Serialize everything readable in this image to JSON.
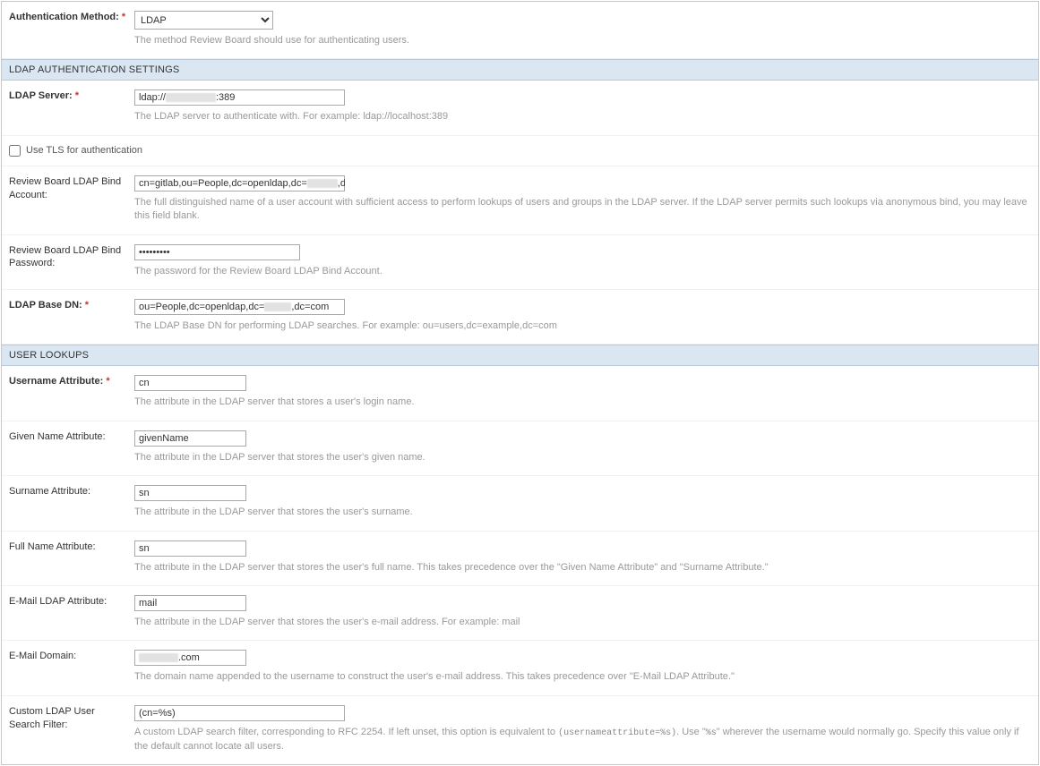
{
  "auth_method": {
    "label": "Authentication Method:",
    "required": "*",
    "value": "LDAP",
    "options": [
      "LDAP"
    ],
    "help": "The method Review Board should use for authenticating users."
  },
  "sections": {
    "ldap_settings_header": "LDAP AUTHENTICATION SETTINGS",
    "user_lookups_header": "USER LOOKUPS"
  },
  "ldap": {
    "server": {
      "label": "LDAP Server:",
      "required": "*",
      "value_prefix": "ldap://",
      "value_suffix": ":389",
      "help": "The LDAP server to authenticate with. For example: ldap://localhost:389"
    },
    "use_tls_label": "Use TLS for authentication",
    "bind_account": {
      "label": "Review Board LDAP Bind Account:",
      "value_prefix": "cn=gitlab,ou=People,dc=openldap,dc=",
      "value_suffix": ",dc=",
      "help": "The full distinguished name of a user account with sufficient access to perform lookups of users and groups in the LDAP server. If the LDAP server permits such lookups via anonymous bind, you may leave this field blank."
    },
    "bind_password": {
      "label": "Review Board LDAP Bind Password:",
      "value": "•••••••••",
      "help": "The password for the Review Board LDAP Bind Account."
    },
    "base_dn": {
      "label": "LDAP Base DN:",
      "required": "*",
      "value_prefix": "ou=People,dc=openldap,dc=",
      "value_suffix": ",dc=com",
      "help": "The LDAP Base DN for performing LDAP searches. For example: ou=users,dc=example,dc=com"
    }
  },
  "lookups": {
    "username_attr": {
      "label": "Username Attribute:",
      "required": "*",
      "value": "cn",
      "help": "The attribute in the LDAP server that stores a user's login name."
    },
    "given_name_attr": {
      "label": "Given Name Attribute:",
      "value": "givenName",
      "help": "The attribute in the LDAP server that stores the user's given name."
    },
    "surname_attr": {
      "label": "Surname Attribute:",
      "value": "sn",
      "help": "The attribute in the LDAP server that stores the user's surname."
    },
    "full_name_attr": {
      "label": "Full Name Attribute:",
      "value": "sn",
      "help": "The attribute in the LDAP server that stores the user's full name. This takes precedence over the \"Given Name Attribute\" and \"Surname Attribute.\""
    },
    "email_attr": {
      "label": "E-Mail LDAP Attribute:",
      "value": "mail",
      "help": "The attribute in the LDAP server that stores the user's e-mail address. For example: mail"
    },
    "email_domain": {
      "label": "E-Mail Domain:",
      "value_suffix": ".com",
      "help": "The domain name appended to the username to construct the user's e-mail address. This takes precedence over \"E-Mail LDAP Attribute.\""
    },
    "custom_filter": {
      "label": "Custom LDAP User Search Filter:",
      "value": "(cn=%s)",
      "help_pre": "A custom LDAP search filter, corresponding to RFC 2254. If left unset, this option is equivalent to ",
      "help_code": "(usernameattribute=%s)",
      "help_mid": ". Use \"",
      "help_token": "%s",
      "help_post": "\" wherever the username would normally go. Specify this value only if the default cannot locate all users."
    }
  }
}
